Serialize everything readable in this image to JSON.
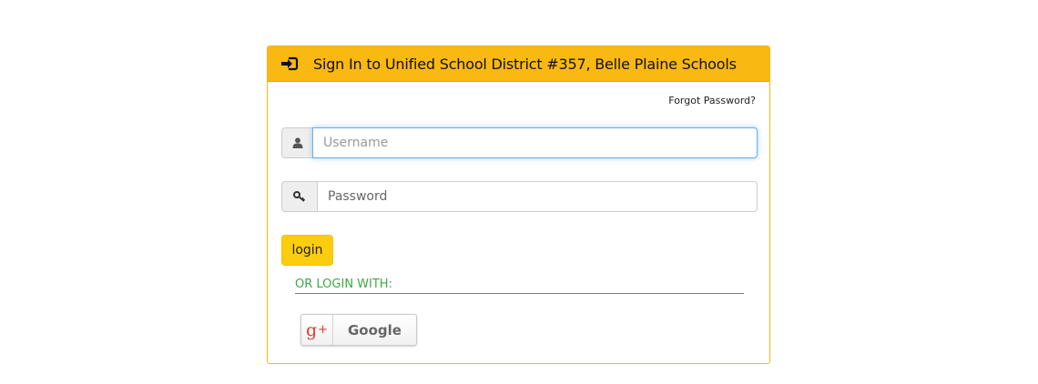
{
  "panel": {
    "title": "Sign In to Unified School District #357, Belle Plaine Schools",
    "title_icon": "sign-in-icon",
    "accent_color": "#fab812"
  },
  "form": {
    "forgot_password": "Forgot Password?",
    "username": {
      "placeholder": "Username",
      "value": "",
      "icon": "user-icon"
    },
    "password": {
      "placeholder": "Password",
      "value": "",
      "icon": "key-icon"
    },
    "login_label": "login"
  },
  "social": {
    "heading": "OR LOGIN WITH:",
    "heading_color": "#3fa845",
    "google_label": "Google",
    "google_icon": "google-plus-icon"
  }
}
